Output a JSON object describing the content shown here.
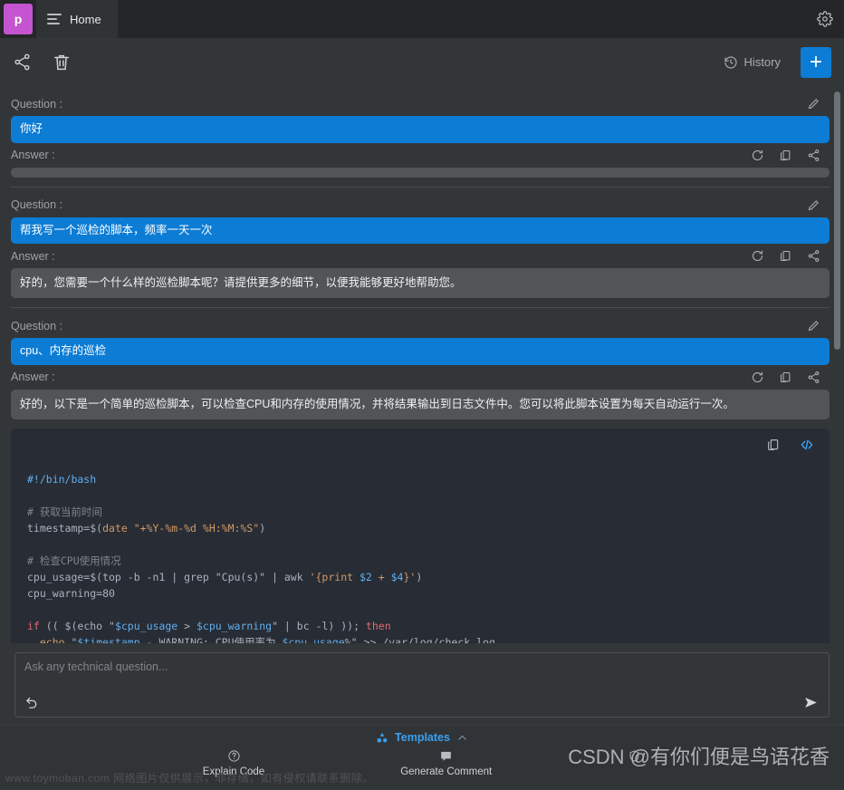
{
  "titlebar": {
    "logo_letter": "p",
    "tab_label": "Home",
    "menu_icon": "hamburger-icon",
    "settings_icon": "gear-icon"
  },
  "toolbar": {
    "share_icon": "share-icon",
    "delete_icon": "trash-icon",
    "history_label": "History",
    "history_icon": "history-clock-icon",
    "new_label": "+"
  },
  "conversation": {
    "question_label": "Question :",
    "answer_label": "Answer :",
    "edit_icon": "pencil-icon",
    "refresh_icon": "refresh-icon",
    "copy_icon": "copy-icon",
    "share_icon": "share-icon",
    "blocks": [
      {
        "question": "你好",
        "answer": ""
      },
      {
        "question": "帮我写一个巡检的脚本，频率一天一次",
        "answer": "好的，您需要一个什么样的巡检脚本呢？请提供更多的细节，以便我能够更好地帮助您。"
      },
      {
        "question": "cpu、内存的巡检",
        "answer": "好的，以下是一个简单的巡检脚本，可以检查CPU和内存的使用情况，并将结果输出到日志文件中。您可以将此脚本设置为每天自动运行一次。"
      }
    ]
  },
  "code_block": {
    "copy_icon": "copy-icon",
    "code_icon": "code-brackets-icon",
    "language": "bash",
    "lines": [
      "#!/bin/bash",
      "",
      "# 获取当前时间",
      "timestamp=$(date \"+%Y-%m-%d %H:%M:%S\")",
      "",
      "# 检查CPU使用情况",
      "cpu_usage=$(top -b -n1 | grep \"Cpu(s)\" | awk '{print $2 + $4}')",
      "cpu_warning=80",
      "",
      "if (( $(echo \"$cpu_usage > $cpu_warning\" | bc -l) )); then",
      "  echo \"$timestamp - WARNING: CPU使用率为 $cpu_usage%\" >> /var/log/check.log"
    ]
  },
  "ask": {
    "placeholder": "Ask any technical question...",
    "value": "",
    "undo_icon": "undo-icon",
    "send_icon": "send-arrow-icon"
  },
  "bottom": {
    "templates_label": "Templates",
    "templates_icon": "shapes-icon",
    "chevron_icon": "chevron-up-icon",
    "actions": [
      {
        "label": "Explain Code",
        "icon": "question-circle-icon"
      },
      {
        "label": "Generate Comment",
        "icon": "comment-icon"
      },
      {
        "label": "",
        "icon": "shield-icon"
      }
    ]
  },
  "watermarks": {
    "left": "www.toymoban.com 网络图片仅供展示，非存储，如有侵权请联系删除。",
    "csdn": "CSDN @有你们便是鸟语花香"
  },
  "colors": {
    "accent_blue": "#0c7cd5",
    "logo_purple": "#c454d0",
    "panel_bg": "#333638",
    "code_bg": "#282c34",
    "answer_bg": "#525558"
  }
}
